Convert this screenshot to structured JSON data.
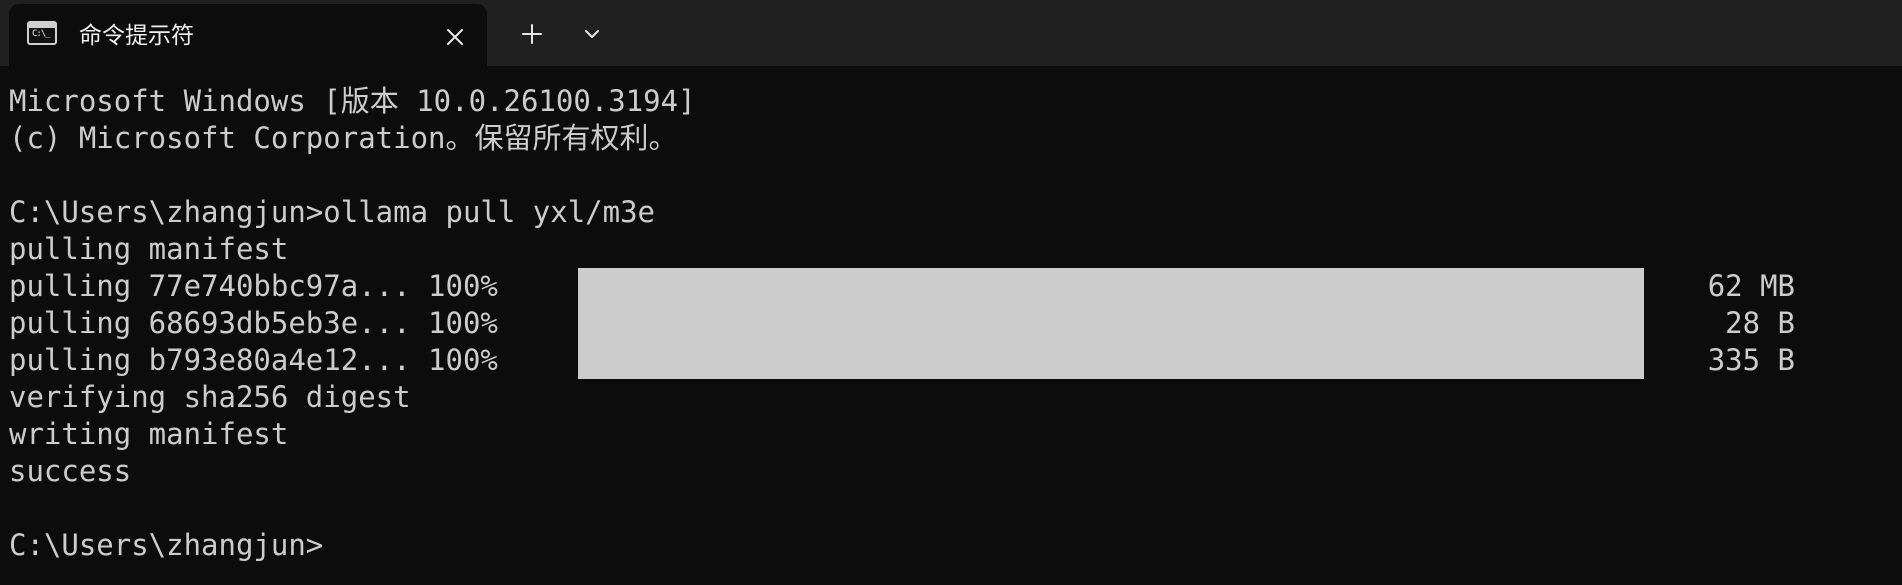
{
  "tab": {
    "title": "命令提示符",
    "icon_label": "C:\\_"
  },
  "terminal": {
    "lines": [
      "Microsoft Windows [版本 10.0.26100.3194]",
      "(c) Microsoft Corporation。保留所有权利。",
      "",
      "C:\\Users\\zhangjun>ollama pull yxl/m3e",
      "pulling manifest",
      "pulling 77e740bbc97a... 100%",
      "pulling 68693db5eb3e... 100%",
      "pulling b793e80a4e12... 100%",
      "verifying sha256 digest",
      "writing manifest",
      "success",
      "",
      "C:\\Users\\zhangjun>"
    ],
    "layers": [
      {
        "progress": 1.0,
        "size": "62 MB"
      },
      {
        "progress": 1.0,
        "size": "28 B"
      },
      {
        "progress": 1.0,
        "size": "335 B"
      }
    ]
  },
  "colors": {
    "background": "#0c0c0c",
    "tabbar": "#202020",
    "text": "#cccccc",
    "progress_fill": "#cccccc"
  }
}
